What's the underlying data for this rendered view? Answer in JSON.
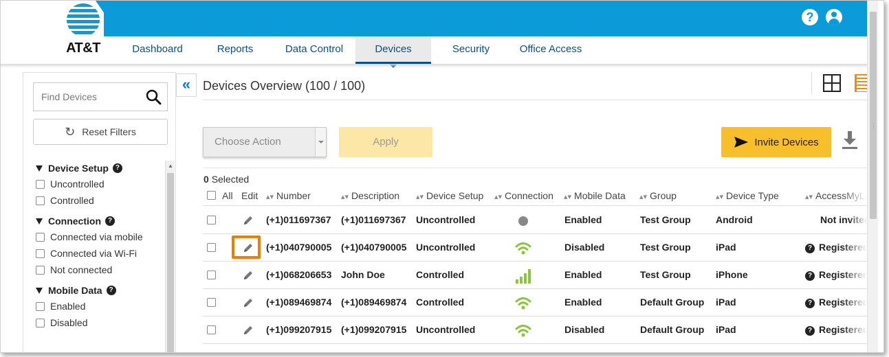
{
  "brand": {
    "logo_text": "AT&T",
    "topbar_color": "#0a9bd8",
    "accent_color": "#f8bf2c"
  },
  "header": {
    "nav": [
      {
        "label": "Dashboard",
        "active": false
      },
      {
        "label": "Reports",
        "active": false
      },
      {
        "label": "Data Control",
        "active": false
      },
      {
        "label": "Devices",
        "active": true
      },
      {
        "label": "Security",
        "active": false
      },
      {
        "label": "Office Access",
        "active": false
      }
    ],
    "help_icon": "?"
  },
  "sidebar": {
    "search": {
      "placeholder": "Find Devices"
    },
    "reset_label": "Reset Filters",
    "filter_groups": [
      {
        "title": "Device Setup",
        "options": [
          "Uncontrolled",
          "Controlled"
        ]
      },
      {
        "title": "Connection",
        "options": [
          "Connected via mobile",
          "Connected via Wi-Fi",
          "Not connected"
        ]
      },
      {
        "title": "Mobile Data",
        "options": [
          "Enabled",
          "Disabled"
        ]
      }
    ]
  },
  "main": {
    "title": "Devices Overview (100 / 100)",
    "choose_action_placeholder": "Choose Action",
    "apply_label": "Apply",
    "invite_label": "Invite Devices",
    "selected_count": "0",
    "selected_label": "Selected",
    "columns": [
      "All",
      "Edit",
      "Number",
      "Description",
      "Device Setup",
      "Connection",
      "Mobile Data",
      "Group",
      "Device Type",
      "AccessMyLAN"
    ],
    "rows": [
      {
        "number": "(+1)011697367",
        "description": "(+1)011697367",
        "setup": "Uncontrolled",
        "connection": "none",
        "mobile_data": "Enabled",
        "group": "Test Group",
        "type": "Android",
        "access": "Not invited",
        "access_help": false,
        "edit_highlighted": false
      },
      {
        "number": "(+1)040790005",
        "description": "(+1)040790005",
        "setup": "Uncontrolled",
        "connection": "wifi",
        "mobile_data": "Disabled",
        "group": "Test Group",
        "type": "iPad",
        "access": "Registered",
        "access_help": true,
        "edit_highlighted": true
      },
      {
        "number": "(+1)068206653",
        "description": "John Doe",
        "setup": "Controlled",
        "connection": "mobile",
        "mobile_data": "Enabled",
        "group": "Test Group",
        "type": "iPhone",
        "access": "Registered",
        "access_help": true,
        "edit_highlighted": false
      },
      {
        "number": "(+1)089469874",
        "description": "(+1)089469874",
        "setup": "Controlled",
        "connection": "wifi",
        "mobile_data": "Enabled",
        "group": "Default Group",
        "type": "iPad",
        "access": "Registered",
        "access_help": true,
        "edit_highlighted": false
      },
      {
        "number": "(+1)099207915",
        "description": "(+1)099207915",
        "setup": "Uncontrolled",
        "connection": "wifi",
        "mobile_data": "Disabled",
        "group": "Default Group",
        "type": "iPad",
        "access": "Registered",
        "access_help": true,
        "edit_highlighted": false
      }
    ]
  },
  "icons": {
    "search": "search-icon",
    "reset": "refresh-icon",
    "edit": "pencil-icon",
    "help": "help-icon",
    "user": "user-icon",
    "invite": "send-icon",
    "download": "download-icon"
  }
}
